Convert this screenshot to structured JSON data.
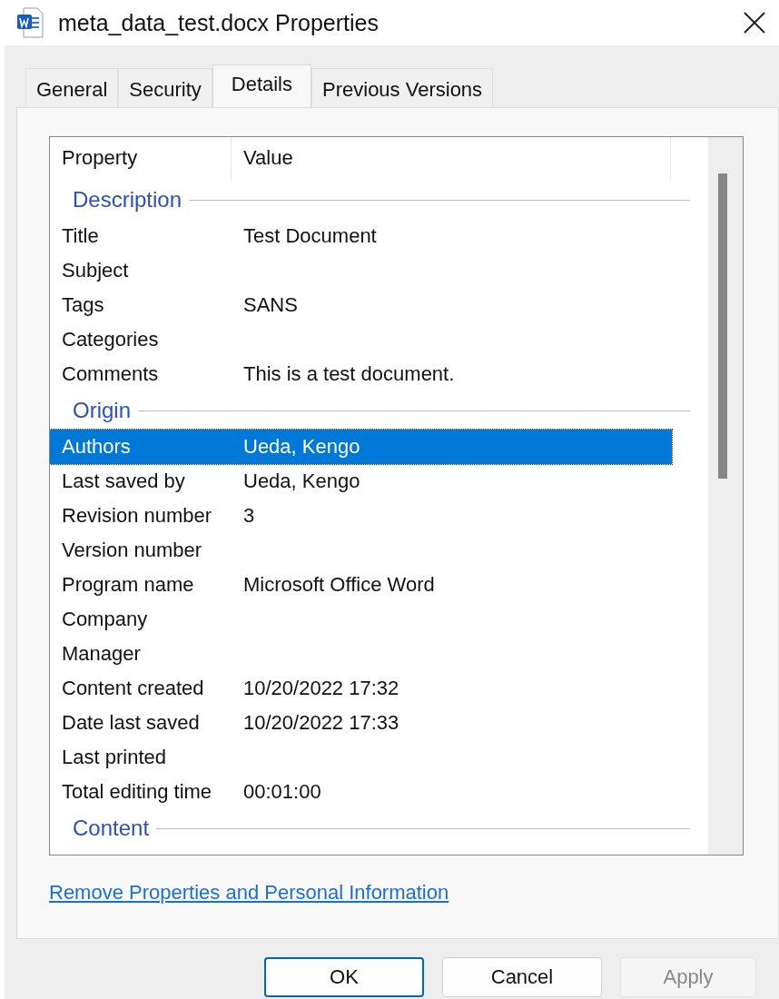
{
  "window": {
    "title": "meta_data_test.docx Properties"
  },
  "tabs": [
    {
      "label": "General",
      "selected": false
    },
    {
      "label": "Security",
      "selected": false
    },
    {
      "label": "Details",
      "selected": true
    },
    {
      "label": "Previous Versions",
      "selected": false
    }
  ],
  "list": {
    "columns": [
      "Property",
      "Value"
    ],
    "items": [
      {
        "kind": "group",
        "label": "Description"
      },
      {
        "kind": "property",
        "name": "Title",
        "value": "Test Document",
        "selected": false
      },
      {
        "kind": "property",
        "name": "Subject",
        "selected": false
      },
      {
        "kind": "property",
        "name": "Tags",
        "value": "SANS",
        "selected": false
      },
      {
        "kind": "property",
        "name": "Categories",
        "selected": false
      },
      {
        "kind": "property",
        "name": "Comments",
        "value": "This is a test document.",
        "selected": false
      },
      {
        "kind": "group",
        "label": "Origin"
      },
      {
        "kind": "property",
        "name": "Authors",
        "value": "Ueda, Kengo",
        "selected": true
      },
      {
        "kind": "property",
        "name": "Last saved by",
        "value": "Ueda, Kengo",
        "selected": false
      },
      {
        "kind": "property",
        "name": "Revision number",
        "value": "3",
        "selected": false
      },
      {
        "kind": "property",
        "name": "Version number",
        "selected": false
      },
      {
        "kind": "property",
        "name": "Program name",
        "value": "Microsoft Office Word",
        "selected": false
      },
      {
        "kind": "property",
        "name": "Company",
        "selected": false
      },
      {
        "kind": "property",
        "name": "Manager",
        "selected": false
      },
      {
        "kind": "property",
        "name": "Content created",
        "value": "10/20/2022 17:32",
        "selected": false
      },
      {
        "kind": "property",
        "name": "Date last saved",
        "value": "10/20/2022 17:33",
        "selected": false
      },
      {
        "kind": "property",
        "name": "Last printed",
        "selected": false
      },
      {
        "kind": "property",
        "name": "Total editing time",
        "value": "00:01:00",
        "selected": false
      },
      {
        "kind": "group",
        "label": "Content"
      }
    ]
  },
  "link": "Remove Properties and Personal Information",
  "buttons": [
    {
      "label": "OK",
      "default": true,
      "disabled": false
    },
    {
      "label": "Cancel",
      "default": false,
      "disabled": false
    },
    {
      "label": "Apply",
      "default": false,
      "disabled": true
    }
  ]
}
